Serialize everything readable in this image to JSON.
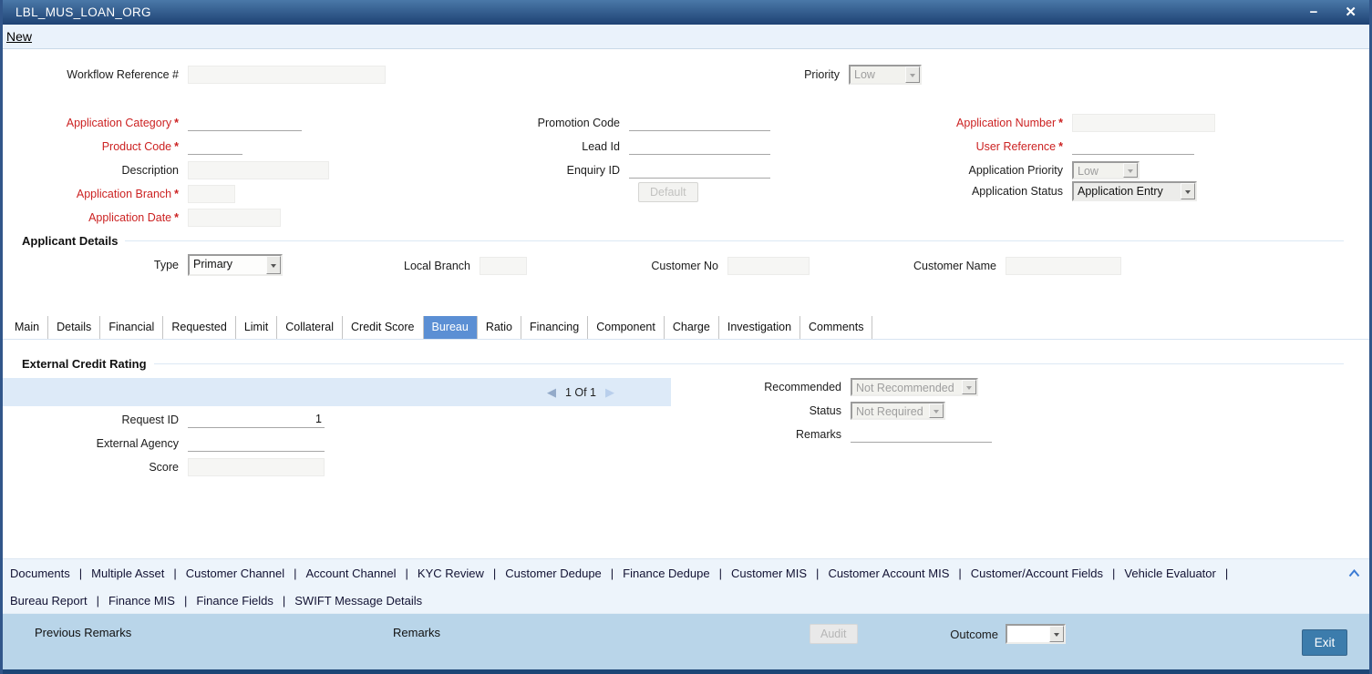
{
  "window": {
    "title": "LBL_MUS_LOAN_ORG",
    "minimize_icon": "−",
    "close_icon": "✕"
  },
  "menu": {
    "new_label": "New"
  },
  "form": {
    "required_marker": "*",
    "workflow_reference": {
      "label": "Workflow Reference #",
      "value": ""
    },
    "priority": {
      "label": "Priority",
      "value": "Low"
    },
    "application_category": {
      "label": "Application Category",
      "value": ""
    },
    "product_code": {
      "label": "Product Code",
      "value": ""
    },
    "description": {
      "label": "Description",
      "value": ""
    },
    "application_branch": {
      "label": "Application Branch",
      "value": ""
    },
    "application_date": {
      "label": "Application Date",
      "value": ""
    },
    "promotion_code": {
      "label": "Promotion Code",
      "value": ""
    },
    "lead_id": {
      "label": "Lead Id",
      "value": ""
    },
    "enquiry_id": {
      "label": "Enquiry ID",
      "value": ""
    },
    "default_button": "Default",
    "application_number": {
      "label": "Application Number",
      "value": ""
    },
    "user_reference": {
      "label": "User Reference",
      "value": ""
    },
    "application_priority": {
      "label": "Application Priority",
      "value": "Low"
    },
    "application_status": {
      "label": "Application Status",
      "value": "Application Entry"
    }
  },
  "applicant_details": {
    "header": "Applicant Details",
    "type": {
      "label": "Type",
      "value": "Primary"
    },
    "local_branch": {
      "label": "Local Branch",
      "value": ""
    },
    "customer_no": {
      "label": "Customer No",
      "value": ""
    },
    "customer_name": {
      "label": "Customer Name",
      "value": ""
    }
  },
  "tabs": {
    "items": [
      {
        "label": "Main"
      },
      {
        "label": "Details"
      },
      {
        "label": "Financial"
      },
      {
        "label": "Requested"
      },
      {
        "label": "Limit"
      },
      {
        "label": "Collateral"
      },
      {
        "label": "Credit Score"
      },
      {
        "label": "Bureau",
        "active": true
      },
      {
        "label": "Ratio"
      },
      {
        "label": "Financing"
      },
      {
        "label": "Component"
      },
      {
        "label": "Charge"
      },
      {
        "label": "Investigation"
      },
      {
        "label": "Comments"
      }
    ]
  },
  "bureau_tab": {
    "section_header": "External Credit Rating",
    "pagination": {
      "prev_icon": "◀",
      "label": "1 Of 1",
      "next_icon": "▶"
    },
    "request_id": {
      "label": "Request ID",
      "value": "1"
    },
    "external_agency": {
      "label": "External Agency",
      "value": ""
    },
    "score": {
      "label": "Score",
      "value": ""
    },
    "recommended": {
      "label": "Recommended",
      "value": "Not Recommended"
    },
    "status": {
      "label": "Status",
      "value": "Not Required"
    },
    "remarks": {
      "label": "Remarks",
      "value": ""
    }
  },
  "links": {
    "separator": "|",
    "row1": [
      "Documents",
      "Multiple Asset",
      "Customer Channel",
      "Account Channel",
      "KYC Review",
      "Customer Dedupe",
      "Finance Dedupe",
      "Customer MIS",
      "Customer Account MIS",
      "Customer/Account Fields",
      "Vehicle Evaluator"
    ],
    "row2": [
      "Bureau Report",
      "Finance MIS",
      "Finance Fields",
      "SWIFT Message Details"
    ]
  },
  "footer": {
    "previous_remarks_label": "Previous Remarks",
    "remarks_label": "Remarks",
    "audit_button": "Audit",
    "outcome_label": "Outcome",
    "outcome_value": "",
    "exit_button": "Exit"
  },
  "colors": {
    "titlebar_top": "#4a78a8",
    "titlebar_bottom": "#1e4273",
    "window_border": "#31568a",
    "mandatory_label": "#cc2222",
    "active_tab": "#5b8fd4",
    "pagination_bar": "#ddeaf8",
    "links_bar": "#edf4fb",
    "footer_bar": "#b9d5e9",
    "exit_button": "#3c7cac"
  }
}
